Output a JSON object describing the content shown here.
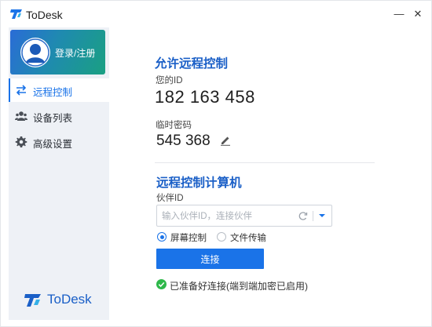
{
  "app": {
    "title": "ToDesk",
    "brand_name": "ToDesk",
    "accent_color": "#1a73e8"
  },
  "window_controls": {
    "minimize": "—",
    "close": "✕"
  },
  "sidebar": {
    "login_label": "登录/注册",
    "items": [
      {
        "label": "远程控制",
        "icon": "swap-arrows-icon",
        "active": true
      },
      {
        "label": "设备列表",
        "icon": "users-icon",
        "active": false
      },
      {
        "label": "高级设置",
        "icon": "gear-icon",
        "active": false
      }
    ]
  },
  "allow_remote": {
    "heading": "允许远程控制",
    "id_label": "您的ID",
    "id_value": "182 163 458",
    "password_label": "临时密码",
    "password_value": "545 368"
  },
  "control_remote": {
    "heading": "远程控制计算机",
    "partner_label": "伙伴ID",
    "partner_placeholder": "输入伙伴ID，连接伙伴",
    "modes": [
      {
        "label": "屏幕控制",
        "checked": true
      },
      {
        "label": "文件传输",
        "checked": false
      }
    ],
    "connect_label": "连接",
    "status_text": "已准备好连接(端到端加密已启用)"
  }
}
